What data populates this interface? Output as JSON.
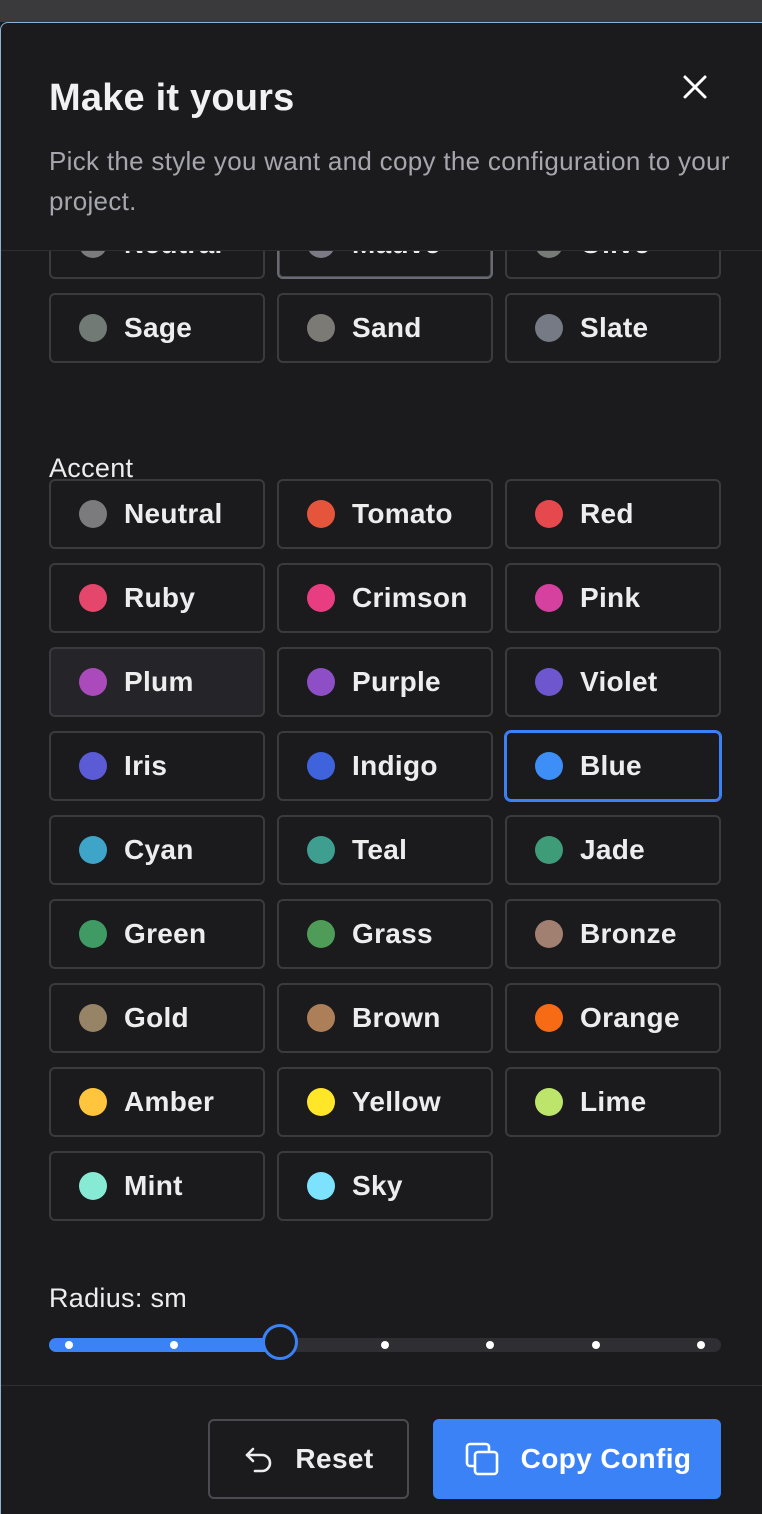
{
  "header": {
    "title": "Make it yours",
    "subtitle": "Pick the style you want and copy the configuration to your project."
  },
  "gray_colors": [
    {
      "label": "Neutral",
      "color": "#7b7b7e",
      "selected": false
    },
    {
      "label": "Mauve",
      "color": "#7c7b85",
      "selected": true
    },
    {
      "label": "Olive",
      "color": "#777b76",
      "selected": false
    },
    {
      "label": "Sage",
      "color": "#717a75",
      "selected": false
    },
    {
      "label": "Sand",
      "color": "#7b7a74",
      "selected": false
    },
    {
      "label": "Slate",
      "color": "#767a84",
      "selected": false
    }
  ],
  "accent": {
    "label": "Accent",
    "colors": [
      {
        "label": "Neutral",
        "color": "#7b7b7e"
      },
      {
        "label": "Tomato",
        "color": "#e5553c"
      },
      {
        "label": "Red",
        "color": "#e5484d"
      },
      {
        "label": "Ruby",
        "color": "#e5466b"
      },
      {
        "label": "Crimson",
        "color": "#e93d82"
      },
      {
        "label": "Pink",
        "color": "#d6409f"
      },
      {
        "label": "Plum",
        "color": "#ab4aba"
      },
      {
        "label": "Purple",
        "color": "#8e4ec6"
      },
      {
        "label": "Violet",
        "color": "#6e56cf"
      },
      {
        "label": "Iris",
        "color": "#5b5bd6"
      },
      {
        "label": "Indigo",
        "color": "#3e63dd"
      },
      {
        "label": "Blue",
        "color": "#3e8ef7"
      },
      {
        "label": "Cyan",
        "color": "#3ea5c9"
      },
      {
        "label": "Teal",
        "color": "#3e9e90"
      },
      {
        "label": "Jade",
        "color": "#3f9c79"
      },
      {
        "label": "Green",
        "color": "#3f9b63"
      },
      {
        "label": "Grass",
        "color": "#4f9c58"
      },
      {
        "label": "Bronze",
        "color": "#a18072"
      },
      {
        "label": "Gold",
        "color": "#978365"
      },
      {
        "label": "Brown",
        "color": "#ad7f58"
      },
      {
        "label": "Orange",
        "color": "#f76b15"
      },
      {
        "label": "Amber",
        "color": "#ffc53d"
      },
      {
        "label": "Yellow",
        "color": "#ffe629"
      },
      {
        "label": "Lime",
        "color": "#bde56c"
      },
      {
        "label": "Mint",
        "color": "#86ead4"
      },
      {
        "label": "Sky",
        "color": "#7ce2fe"
      }
    ],
    "selected": "Blue",
    "hovered": "Plum"
  },
  "radius": {
    "label": "Radius: sm",
    "steps": 7,
    "selected_index": 2
  },
  "footer": {
    "reset_label": "Reset",
    "copy_label": "Copy Config"
  },
  "colors": {
    "accent": "#3b82f6",
    "background": "#1b1b1e",
    "border": "#3a3a3f"
  }
}
